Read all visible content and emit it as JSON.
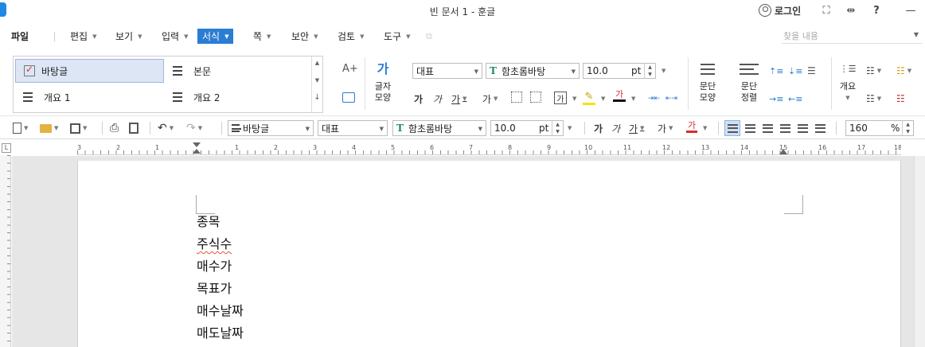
{
  "window": {
    "title": "빈 문서 1 - 훈글",
    "login_label": "로그인",
    "buttons": [
      "⛶",
      "⇹",
      "?",
      "—"
    ]
  },
  "menu": {
    "items": [
      {
        "label": "파일",
        "caret": false
      },
      {
        "label": "편집",
        "caret": true
      },
      {
        "label": "보기",
        "caret": true
      },
      {
        "label": "입력",
        "caret": true
      },
      {
        "label": "서식",
        "caret": true,
        "active": true
      },
      {
        "label": "쪽",
        "caret": true
      },
      {
        "label": "보안",
        "caret": true
      },
      {
        "label": "검토",
        "caret": true
      },
      {
        "label": "도구",
        "caret": true
      }
    ],
    "search_placeholder": "찾을 내용"
  },
  "ribbon": {
    "styles": [
      {
        "label": "바탕글",
        "selected": true
      },
      {
        "label": "본문",
        "selected": false
      },
      {
        "label": "개요 1",
        "selected": false
      },
      {
        "label": "개요 2",
        "selected": false
      }
    ],
    "char_shape_label_1": "글자",
    "char_shape_label_2": "모양",
    "font_lang": "대표",
    "font_name": "함초롬바탕",
    "font_size": "10.0",
    "font_unit": "pt",
    "para_shape_label_1": "문단",
    "para_shape_label_2": "모양",
    "para_align_label_1": "문단",
    "para_align_label_2": "정렬",
    "outline_label": "개요",
    "char_buttons": [
      "가",
      "가",
      "가",
      "가"
    ],
    "font_color_glyph": "가"
  },
  "toolbar": {
    "style": "바탕글",
    "font_lang": "대표",
    "font_name": "함초롬바탕",
    "font_size": "10.0",
    "font_unit": "pt",
    "zoom": "160",
    "zoom_unit": "%",
    "char_buttons": [
      "가",
      "가",
      "가",
      "가",
      "가"
    ]
  },
  "ruler": {
    "numbers": [
      "3",
      "2",
      "1",
      "1",
      "1",
      "2",
      "3",
      "4",
      "5",
      "6",
      "7",
      "8",
      "9",
      "10",
      "11",
      "12",
      "13",
      "14",
      "15",
      "16",
      "17",
      "18"
    ]
  },
  "document": {
    "lines": [
      {
        "text": "종목",
        "misspelled": false
      },
      {
        "text": "주식수",
        "misspelled": true
      },
      {
        "text": "매수가",
        "misspelled": false
      },
      {
        "text": "목표가",
        "misspelled": false
      },
      {
        "text": "매수날짜",
        "misspelled": false
      },
      {
        "text": "매도날짜",
        "misspelled": false
      }
    ]
  },
  "colors": {
    "accent": "#2b7cd3",
    "font_green": "#1a8c5b",
    "highlight": "#f5e400",
    "font_red": "#d32f2f"
  }
}
